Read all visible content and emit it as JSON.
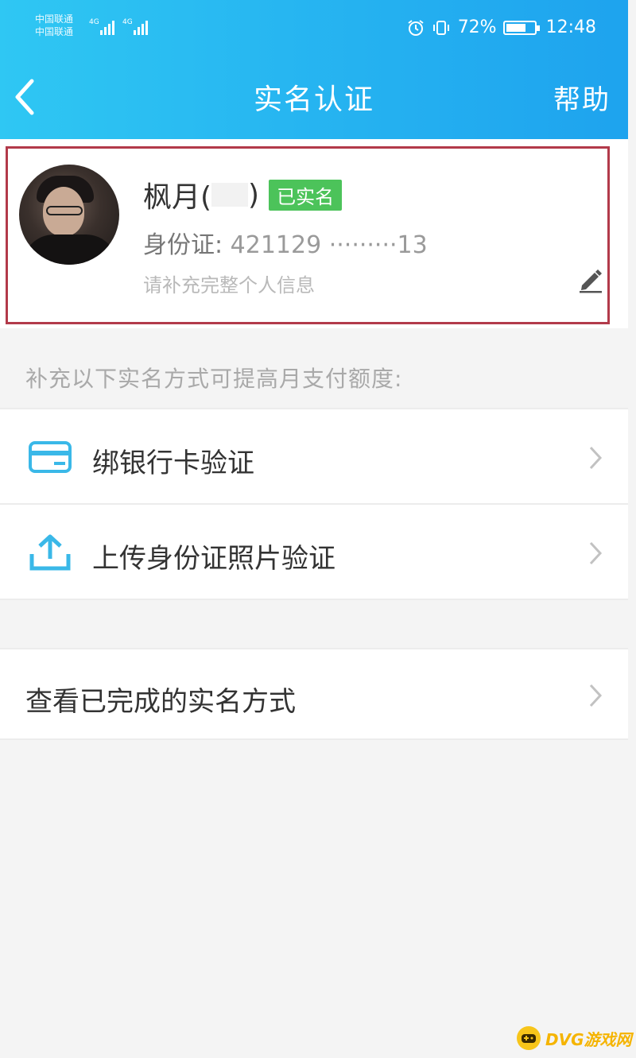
{
  "status_bar": {
    "carrier_1": "中国联通",
    "carrier_2": "中国联通",
    "network_1": "4G",
    "network_2": "4G",
    "battery_percent": "72%",
    "battery_level": 0.72,
    "time": "12:48"
  },
  "header": {
    "back_icon": "chevron-left-icon",
    "title": "实名认证",
    "help_label": "帮助"
  },
  "profile": {
    "name": "枫月(",
    "name_suffix": ")",
    "verified_label": "已实名",
    "id_prefix": "身份证: ",
    "id_value": "421129 ·········13",
    "hint": "请补充完整个人信息",
    "edit_icon": "pencil-icon"
  },
  "supplement_hint": "补充以下实名方式可提高月支付额度:",
  "methods": [
    {
      "label": "绑银行卡验证",
      "icon": "bank-card-icon"
    },
    {
      "label": "上传身份证照片验证",
      "icon": "upload-icon"
    }
  ],
  "completed": {
    "label": "查看已完成的实名方式"
  },
  "watermark": {
    "text": "DVG游戏网"
  },
  "colors": {
    "header_start": "#2fc7f3",
    "header_end": "#1ea3ee",
    "verified_badge": "#4cc35a",
    "highlight_frame": "#b23a4a",
    "icon_blue": "#3ab8e8"
  }
}
